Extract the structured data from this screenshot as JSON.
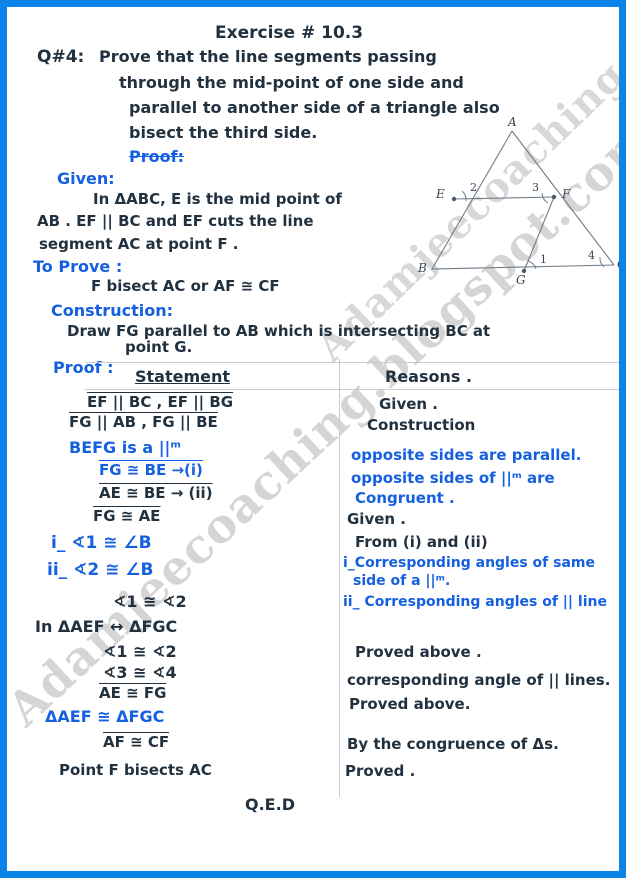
{
  "page": {
    "border_color": "#0a84e8",
    "ink_color": "#22313f",
    "blue_color": "#1560e0",
    "watermark": "Adamjeecoaching.blogspot.com"
  },
  "header": {
    "exercise": "Exercise  # 10.3",
    "question_label": "Q#4:",
    "question_lines": [
      "Prove  that   the  line  segments  passing",
      "through   the   mid-point  of  one  side   and",
      "parallel   to another  side  of a  triangle also",
      "bisect   the   third  side."
    ]
  },
  "proof_heading": "Proof:",
  "given": {
    "heading": "Given:",
    "lines": [
      "In  ΔABC, E  is  the  mid point  of",
      "AB . EF  ||  BC  and  EF  cuts  the  line",
      "segment   AC  at  point  F ."
    ]
  },
  "to_prove": {
    "heading": "To  Prove :",
    "line": "F  bisect  AC  or   AF ≅ CF"
  },
  "construction": {
    "heading": "Construction:",
    "lines": [
      "Draw  FG  parallel  to  AB  which  is  intersecting  BC  at",
      "point   G."
    ]
  },
  "proof": {
    "heading": "Proof :",
    "columns": {
      "statement": "Statement",
      "reasons": "Reasons ."
    },
    "statements": [
      {
        "text": "EF  ||  BC  ,  EF  ||  BG",
        "color": "ink"
      },
      {
        "text": "FG  ||  AB  ,  FG  ||  BE",
        "color": "ink"
      },
      {
        "text": "BEFG   is  a    ||ᵐ",
        "color": "blue"
      },
      {
        "text": "FG  ≅  BE   →(i)",
        "color": "blue"
      },
      {
        "text": "AE  ≅  BE   → (ii)",
        "color": "ink"
      },
      {
        "text": "FG  ≅  AE",
        "color": "ink"
      },
      {
        "text": "i_ ∢1  ≅  ∠B",
        "color": "blue"
      },
      {
        "text": "ii_ ∢2  ≅ ∠B",
        "color": "blue"
      },
      {
        "text": "∢1  ≅  ∢2",
        "color": "ink"
      },
      {
        "text": "In  ΔAEF  ↔  ΔFGC",
        "color": "ink"
      },
      {
        "text": "∢1  ≅  ∢2",
        "color": "ink"
      },
      {
        "text": "∢3  ≅  ∢4",
        "color": "ink"
      },
      {
        "text": "AE  ≅  FG",
        "color": "ink"
      },
      {
        "text": "ΔAEF  ≅   ΔFGC",
        "color": "blue"
      },
      {
        "text": "AF  ≅  CF",
        "color": "ink"
      },
      {
        "text": "Point  F   bisects   AC",
        "color": "ink"
      }
    ],
    "reasons": [
      {
        "text": "Given .",
        "color": "ink"
      },
      {
        "text": "Construction",
        "color": "ink"
      },
      {
        "text": "opposite  sides  are  parallel.",
        "color": "blue"
      },
      {
        "text": "opposite  sides  of  ||ᵐ are",
        "color": "blue"
      },
      {
        "text": "Congruent .",
        "color": "blue"
      },
      {
        "text": "Given .",
        "color": "ink"
      },
      {
        "text": "From  (i)  and (ii)",
        "color": "ink"
      },
      {
        "text": "i_Corresponding  angles  of  same",
        "color": "blue"
      },
      {
        "text": "side  of  a  ||ᵐ.",
        "color": "blue"
      },
      {
        "text": "ii_ Corresponding  angles  of  ||  line",
        "color": "blue"
      },
      {
        "text": "Proved    above .",
        "color": "ink"
      },
      {
        "text": "corresponding  angle  of  ||  lines.",
        "color": "ink"
      },
      {
        "text": "Proved  above.",
        "color": "ink"
      },
      {
        "text": "By  the  congruence  of  Δs.",
        "color": "ink"
      },
      {
        "text": "Proved .",
        "color": "ink"
      }
    ]
  },
  "qed": "Q.E.D",
  "diagram": {
    "vertices": {
      "A": "A",
      "B": "B",
      "C": "C",
      "E": "E",
      "F": "F",
      "G": "G"
    },
    "angles": {
      "a1": "1",
      "a2": "2",
      "a3": "3",
      "a4": "4"
    }
  }
}
